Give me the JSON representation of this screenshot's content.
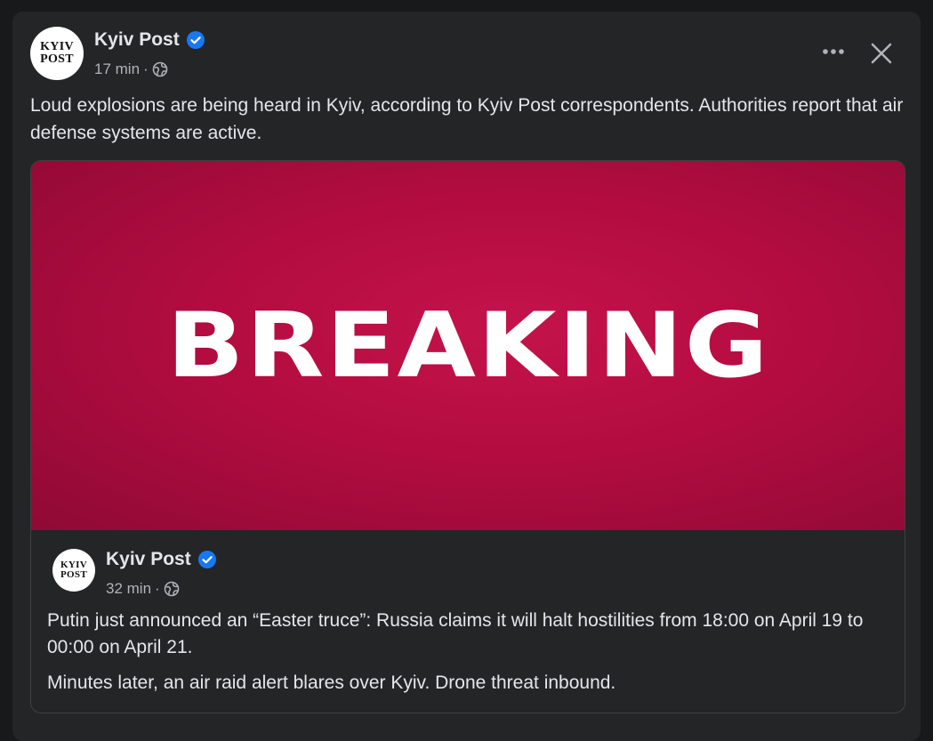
{
  "post": {
    "author": "Kyiv Post",
    "time": "17 min",
    "separator": "·",
    "avatar_line1": "KYIV",
    "avatar_line2": "POST",
    "text": "Loud explosions are being heard in Kyiv, according to Kyiv Post correspondents. Authorities report that air defense systems are active.",
    "more_icon": "more-horizontal-icon",
    "close_icon": "close-icon"
  },
  "shared_post": {
    "image_text": "BREAKING",
    "author": "Kyiv Post",
    "time": "32 min",
    "separator": "·",
    "avatar_line1": "KYIV",
    "avatar_line2": "POST",
    "paragraph1": "Putin just announced an “Easter truce”: Russia claims it will halt hostilities from 18:00 on April 19 to 00:00 on April 21.",
    "paragraph2": "Minutes later, an air raid alert blares over Kyiv. Drone threat inbound."
  },
  "colors": {
    "background": "#18191a",
    "card": "#242526",
    "primary_text": "#e4e6eb",
    "secondary_text": "#b0b3b8",
    "verified_blue": "#1877f2",
    "breaking_red": "#b30c40"
  }
}
